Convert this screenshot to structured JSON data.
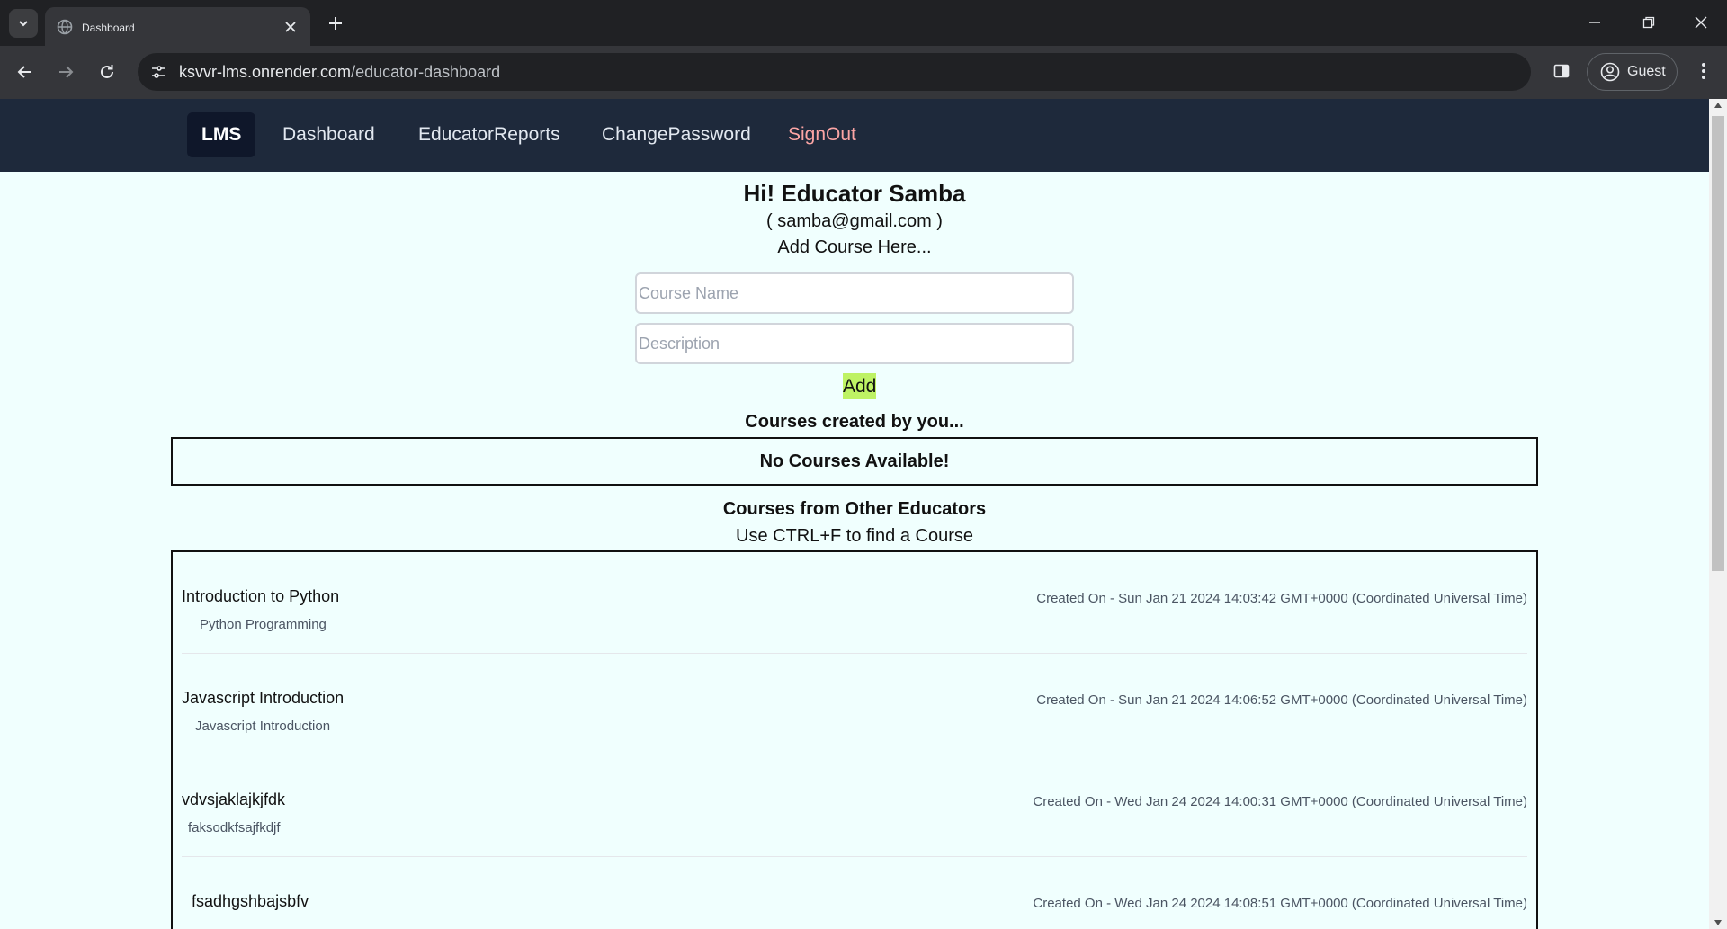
{
  "browser": {
    "tab_title": "Dashboard",
    "url_host": "ksvvr-lms.onrender.com",
    "url_path": "/educator-dashboard",
    "profile_label": "Guest"
  },
  "nav": {
    "brand": "LMS",
    "dashboard": "Dashboard",
    "reports": "EducatorReports",
    "change_password": "ChangePassword",
    "signout": "SignOut"
  },
  "header": {
    "greeting": "Hi! Educator Samba",
    "email": "( samba@gmail.com )",
    "add_hint": "Add Course Here..."
  },
  "form": {
    "course_name_placeholder": "Course Name",
    "description_placeholder": "Description",
    "add_label": "Add"
  },
  "my_courses": {
    "heading": "Courses created by you...",
    "empty_message": "No Courses Available!"
  },
  "other_courses": {
    "heading": "Courses from Other Educators",
    "hint": "Use CTRL+F to find a Course",
    "items": [
      {
        "title": "Introduction to Python",
        "description": "Python Programming",
        "created": "Created On - Sun Jan 21 2024 14:03:42 GMT+0000 (Coordinated Universal Time)"
      },
      {
        "title": "Javascript Introduction",
        "description": "Javascript Introduction",
        "created": "Created On - Sun Jan 21 2024 14:06:52 GMT+0000 (Coordinated Universal Time)"
      },
      {
        "title": "vdvsjaklajkjfdk",
        "description": "faksodkfsajfkdjf",
        "created": "Created On - Wed Jan 24 2024 14:00:31 GMT+0000 (Coordinated Universal Time)"
      },
      {
        "title": "fsadhgshbajsbfv",
        "description": "",
        "created": "Created On - Wed Jan 24 2024 14:08:51 GMT+0000 (Coordinated Universal Time)"
      }
    ]
  },
  "colors": {
    "nav_bg": "#1e293b",
    "brand_bg": "#0f172a",
    "signout": "#fca5a5",
    "page_bg": "#f0fffe",
    "add_button": "#bef264"
  }
}
